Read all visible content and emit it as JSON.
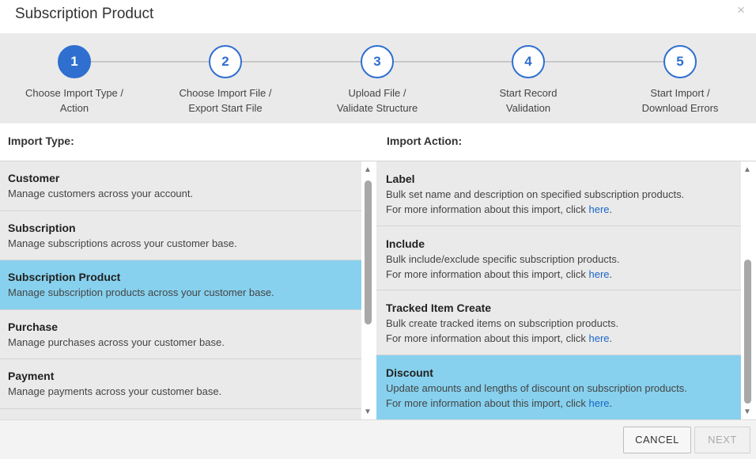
{
  "dialog": {
    "title": "Subscription Product",
    "close_glyph": "×"
  },
  "steps": [
    {
      "number": "1",
      "line1": "Choose Import Type /",
      "line2": "Action",
      "active": true
    },
    {
      "number": "2",
      "line1": "Choose Import File /",
      "line2": "Export Start File",
      "active": false
    },
    {
      "number": "3",
      "line1": "Upload File /",
      "line2": "Validate Structure",
      "active": false
    },
    {
      "number": "4",
      "line1": "Start Record",
      "line2": "Validation",
      "active": false
    },
    {
      "number": "5",
      "line1": "Start Import /",
      "line2": "Download Errors",
      "active": false
    }
  ],
  "import_type": {
    "header": "Import Type:",
    "items": [
      {
        "title": "Customer",
        "description": "Manage customers across your account."
      },
      {
        "title": "Subscription",
        "description": "Manage subscriptions across your customer base."
      },
      {
        "title": "Subscription Product",
        "description": "Manage subscription products across your customer base.",
        "selected": true
      },
      {
        "title": "Purchase",
        "description": "Manage purchases across your customer base."
      },
      {
        "title": "Payment",
        "description": "Manage payments across your customer base."
      }
    ]
  },
  "import_action": {
    "header": "Import Action:",
    "more_info_prefix": "For more information about this import, click ",
    "link_text": "here",
    "suffix": ".",
    "items": [
      {
        "title": "Label",
        "description": "Bulk set name and description on specified subscription products."
      },
      {
        "title": "Include",
        "description": "Bulk include/exclude specific subscription products."
      },
      {
        "title": "Tracked Item Create",
        "description": "Bulk create tracked items on subscription products."
      },
      {
        "title": "Discount",
        "description": "Update amounts and lengths of discount on subscription products.",
        "selected": true
      }
    ]
  },
  "scroll": {
    "up_glyph": "▲",
    "down_glyph": "▼"
  },
  "footer": {
    "cancel_label": "CANCEL",
    "next_label": "NEXT"
  },
  "colors": {
    "accent": "#2f6fd0",
    "selected_row": "#87d1ee",
    "link": "#1a66c4"
  }
}
